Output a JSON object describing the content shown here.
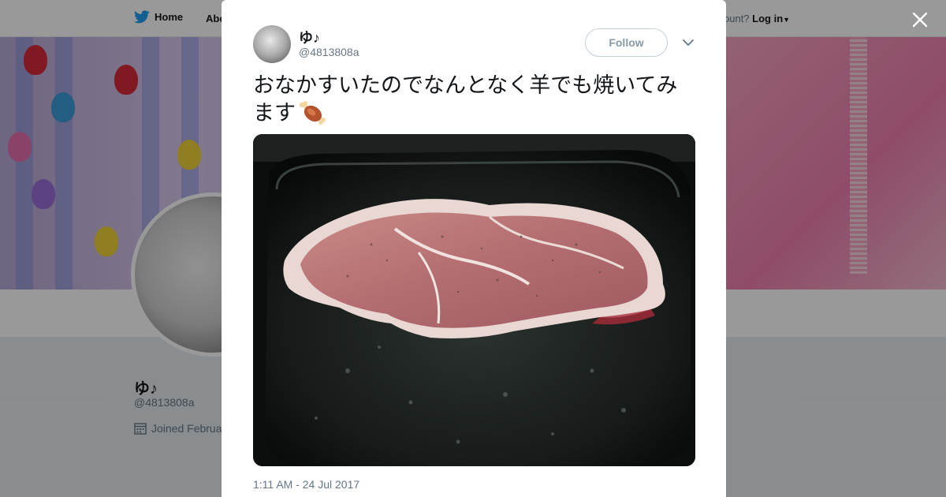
{
  "nav": {
    "home_label": "Home",
    "about_label": "Abo",
    "account_prompt": "ccount?",
    "login_label": "Log in"
  },
  "profile": {
    "name": "ゆ♪",
    "handle": "@4813808a",
    "joined": "Joined Februa"
  },
  "tweet": {
    "author_name": "ゆ♪",
    "author_handle": "@4813808a",
    "follow_label": "Follow",
    "text": "おなかすいたのでなんとなく羊でも焼いてみます",
    "emoji_icon": "meat-on-bone-icon",
    "timestamp": "1:11 AM - 24 Jul 2017"
  },
  "colors": {
    "twitter_blue": "#1da1f2",
    "text_primary": "#14171a",
    "text_secondary": "#657786"
  }
}
